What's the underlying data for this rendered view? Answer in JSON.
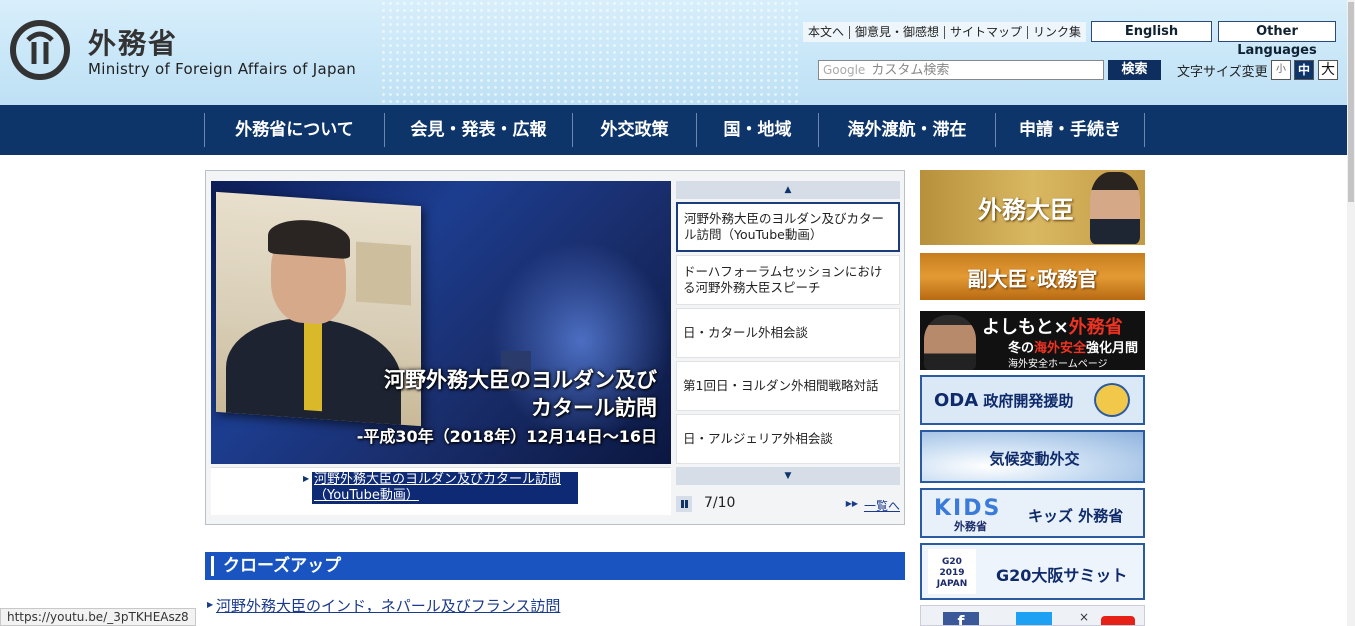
{
  "header": {
    "title_jp": "外務省",
    "title_en": "Ministry of Foreign Affairs of Japan",
    "util_links": [
      "本文へ",
      "御意見・御感想",
      "サイトマップ",
      "リンク集"
    ],
    "english_label": "English",
    "other_lang_label": "Other Languages",
    "search_logo": "Google",
    "search_placeholder": "カスタム検索",
    "search_button": "検索",
    "font_size_label": "文字サイズ変更",
    "font_small": "小",
    "font_medium": "中",
    "font_large": "大"
  },
  "nav": [
    "外務省について",
    "会見・発表・広報",
    "外交政策",
    "国・地域",
    "海外渡航・滞在",
    "申請・手続き"
  ],
  "carousel": {
    "caption_line1": "河野外務大臣のヨルダン及び",
    "caption_line2": "カタール訪問",
    "caption_line3": "-平成30年（2018年）12月14日～16日",
    "slide_link": "河野外務大臣のヨルダン及びカタール訪問（YouTube動画）",
    "items": [
      "河野外務大臣のヨルダン及びカタール訪問（YouTube動画）",
      "ドーハフォーラムセッションにおける河野外務大臣スピーチ",
      "日・カタール外相会談",
      "第1回日・ヨルダン外相間戦略対話",
      "日・アルジェリア外相会談"
    ],
    "page_counter": "7/10",
    "all_link": "一覧へ"
  },
  "closeup": {
    "title": "クローズアップ",
    "first_link": "河野外務大臣のインド，ネパール及びフランス訪問"
  },
  "status_url": "https://youtu.be/_3pTKHEAsz8",
  "banners": {
    "minister": "外務大臣",
    "vice": "副大臣･政務官",
    "yoshimoto_a": "よしもと",
    "yoshimoto_x": "×",
    "yoshimoto_b": "外務省",
    "yoshimoto_sub_a": "冬の",
    "yoshimoto_sub_b": "海外安全",
    "yoshimoto_sub_c": "強化月間",
    "yoshimoto_small": "海外安全ホームページ",
    "oda_big": "ODA",
    "oda_text": "政府開発援助",
    "climate": "気候変動外交",
    "kids_logo": "KIDS",
    "kids_sub": "外務省",
    "kids_text": "キッズ 外務省",
    "g20_logo": "G20 2019 JAPAN",
    "g20_text": "G20大阪サミット",
    "social_fb": "f",
    "social_x": "×"
  }
}
